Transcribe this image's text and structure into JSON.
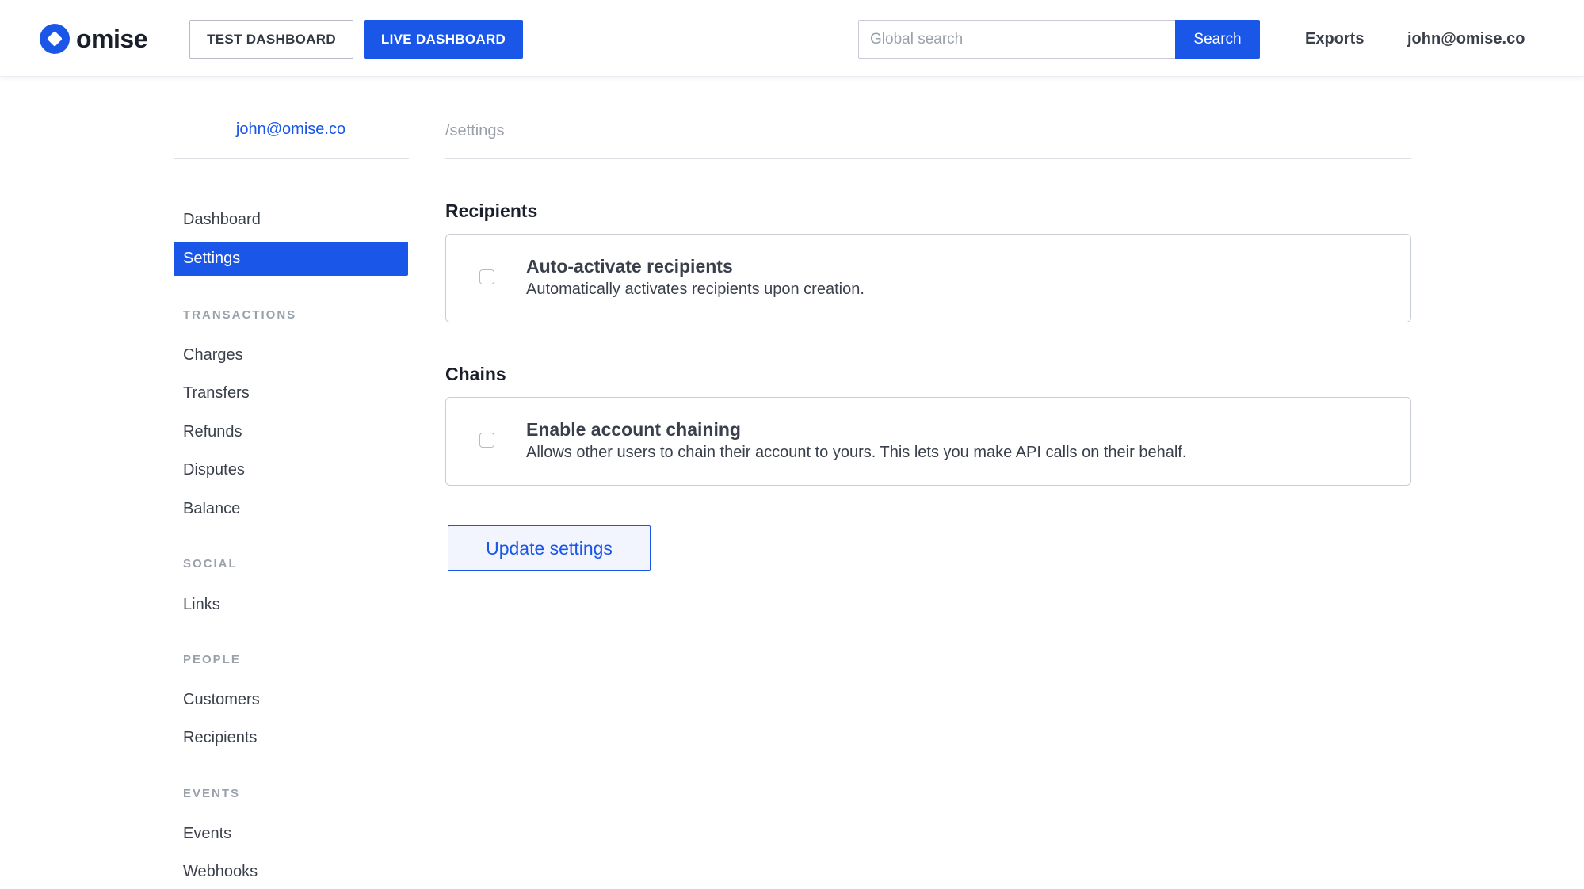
{
  "header": {
    "logo_text": "omise",
    "env_test_label": "TEST DASHBOARD",
    "env_live_label": "LIVE DASHBOARD",
    "search_placeholder": "Global search",
    "search_value": "",
    "search_button_label": "Search",
    "exports_label": "Exports",
    "user_email": "john@omise.co"
  },
  "sidebar": {
    "account_email": "john@omise.co",
    "items": [
      {
        "label": "Dashboard",
        "active": false
      },
      {
        "label": "Settings",
        "active": true
      }
    ],
    "sections": [
      {
        "title": "TRANSACTIONS",
        "items": [
          "Charges",
          "Transfers",
          "Refunds",
          "Disputes",
          "Balance"
        ]
      },
      {
        "title": "SOCIAL",
        "items": [
          "Links"
        ]
      },
      {
        "title": "PEOPLE",
        "items": [
          "Customers",
          "Recipients"
        ]
      },
      {
        "title": "EVENTS",
        "items": [
          "Events",
          "Webhooks"
        ]
      }
    ]
  },
  "main": {
    "breadcrumb": "/settings",
    "recipients": {
      "title": "Recipients",
      "setting_title": "Auto-activate recipients",
      "setting_desc": "Automatically activates recipients upon creation.",
      "checked": false
    },
    "chains": {
      "title": "Chains",
      "setting_title": "Enable account chaining",
      "setting_desc": "Allows other users to chain their account to yours. This lets you make API calls on their behalf.",
      "checked": false
    },
    "update_button_label": "Update settings"
  },
  "colors": {
    "brand_blue": "#1a56e8",
    "text_dark": "#1a1f2b",
    "section_gray": "#9ba1ab"
  }
}
